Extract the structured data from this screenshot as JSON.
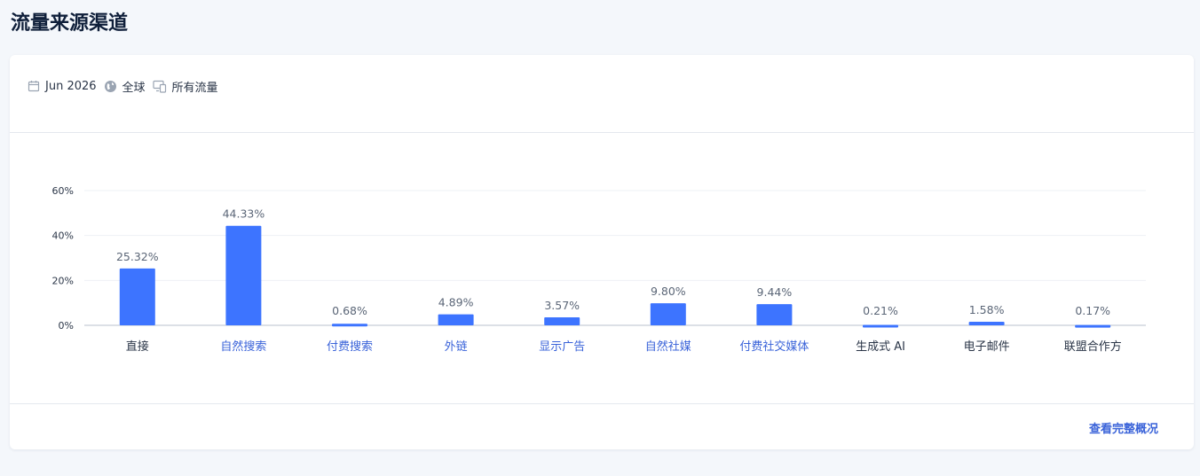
{
  "page": {
    "title": "流量来源渠道"
  },
  "filters": {
    "date": "Jun 2026",
    "region": "全球",
    "traffic": "所有流量"
  },
  "footer": {
    "link_label": "查看完整概况"
  },
  "colors": {
    "bar": "#3d74ff",
    "link": "#3a63d9",
    "plain_text": "#2a3547",
    "grid": "#eef1f5"
  },
  "chart_data": {
    "type": "bar",
    "title": "",
    "xlabel": "",
    "ylabel": "",
    "ylim": [
      0,
      60
    ],
    "yticks": [
      "0%",
      "20%",
      "40%",
      "60%"
    ],
    "ytick_values": [
      0,
      20,
      40,
      60
    ],
    "grid": true,
    "categories": [
      "直接",
      "自然搜索",
      "付费搜索",
      "外链",
      "显示广告",
      "自然社媒",
      "付费社交媒体",
      "生成式 AI",
      "电子邮件",
      "联盟合作方"
    ],
    "values": [
      25.32,
      44.33,
      0.68,
      4.89,
      3.57,
      9.8,
      9.44,
      0.21,
      1.58,
      0.17
    ],
    "value_labels": [
      "25.32%",
      "44.33%",
      "0.68%",
      "4.89%",
      "3.57%",
      "9.80%",
      "9.44%",
      "0.21%",
      "1.58%",
      "0.17%"
    ],
    "category_is_link": [
      false,
      true,
      true,
      true,
      true,
      true,
      true,
      false,
      false,
      false
    ]
  }
}
